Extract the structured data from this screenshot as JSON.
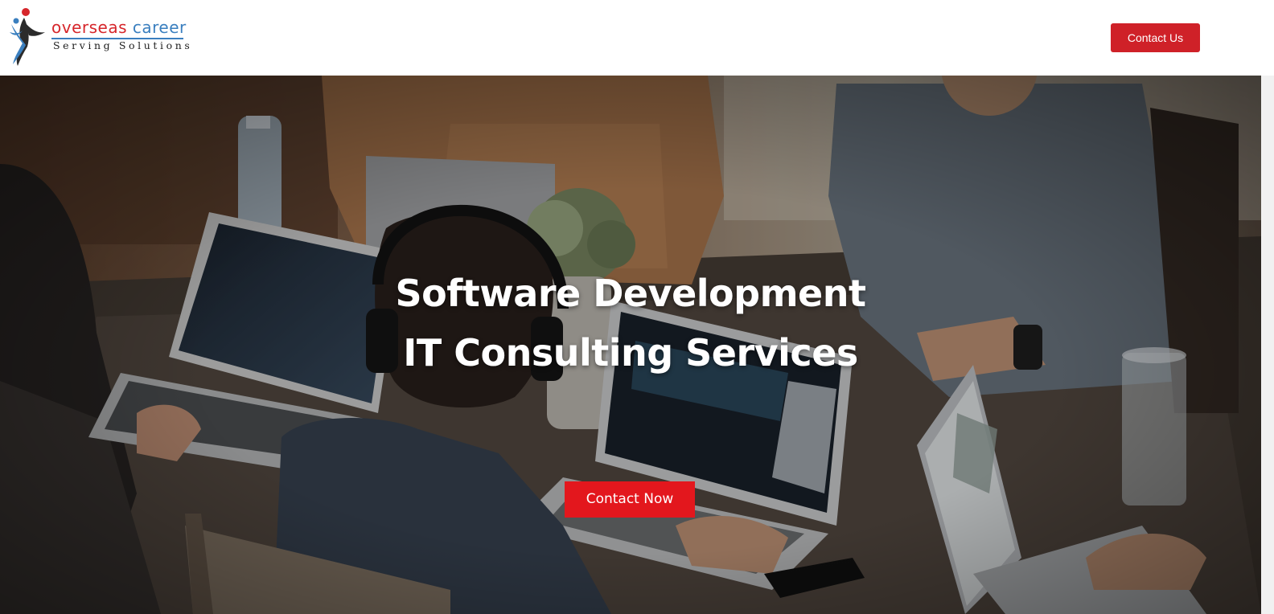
{
  "header": {
    "logo": {
      "word1": "overseas",
      "word2": "career",
      "tagline": "Serving Solutions",
      "icon": "people-logo-icon"
    },
    "contact_us_label": "Contact Us"
  },
  "hero": {
    "title_line1": "Software Development",
    "title_line2": "IT Consulting Services",
    "cta_label": "Contact Now",
    "background": "team-working-on-laptops-photo"
  },
  "colors": {
    "brand_red": "#cf2128",
    "cta_red": "#e3171d",
    "brand_blue": "#3a7fbf"
  }
}
